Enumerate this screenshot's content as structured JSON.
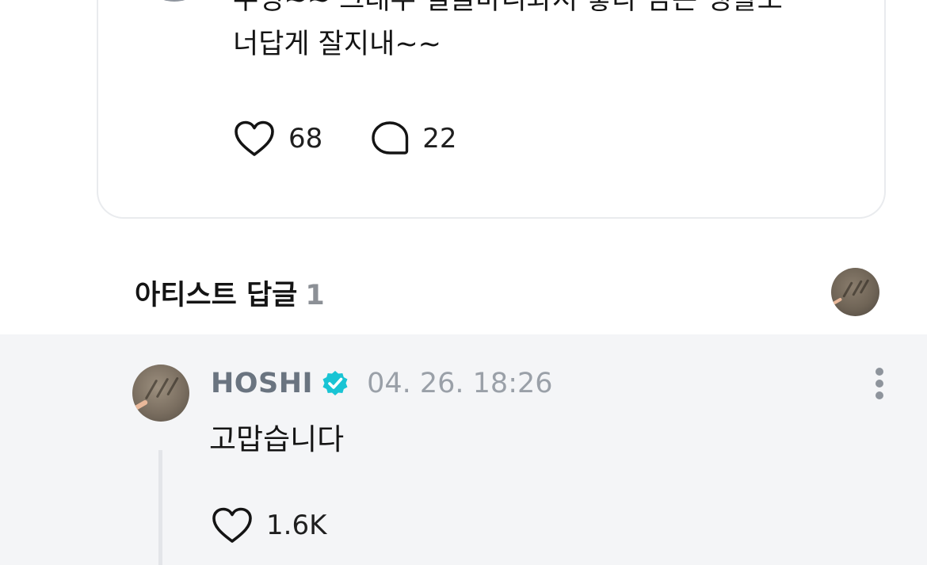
{
  "post": {
    "text_line1": "뚜녕~~ 그래두 얼굴마니봐서 좋다 남은 생활도",
    "text_line2": "너답게 잘지내~~",
    "like_count": "68",
    "comment_count": "22"
  },
  "artist_replies": {
    "title": "아티스트 답글",
    "count": "1"
  },
  "reply": {
    "author": "HOSHI",
    "timestamp": "04. 26. 18:26",
    "text": "고맙습니다",
    "like_count": "1.6K"
  },
  "colors": {
    "verified_badge": "#19c4d4",
    "reply_background": "#f4f5f7",
    "author_name": "#6a7480",
    "timestamp": "#9aa0a8"
  },
  "icons": {
    "like": "heart-outline-icon",
    "comment": "speech-bubble-icon",
    "verified": "verified-badge-icon",
    "more": "more-vertical-icon"
  }
}
